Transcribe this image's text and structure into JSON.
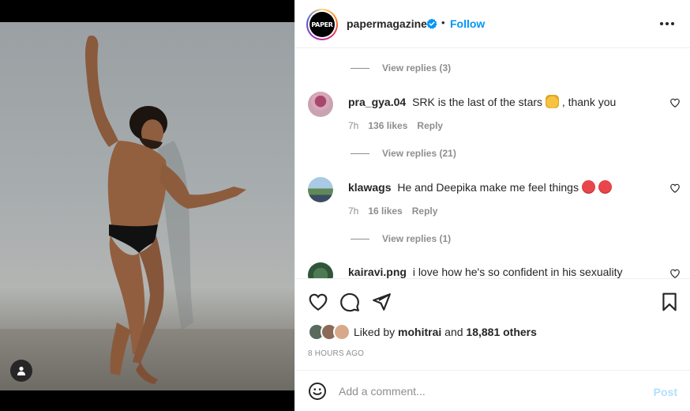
{
  "post": {
    "author": {
      "username": "papermagazine",
      "avatar_text": "PAPER",
      "verified": true,
      "follow_label": "Follow",
      "separator": "•"
    },
    "comments": [
      {
        "view_replies_above": "View replies (3)",
        "username": "pra_gya.04",
        "text_before": "SRK is the last of the stars",
        "emoji": "raising-hands",
        "text_after": ", thank you",
        "time": "7h",
        "likes": "136 likes",
        "reply_label": "Reply",
        "view_replies": "View replies (21)"
      },
      {
        "username": "klawags",
        "text_before": "He and Deepika make me feel things",
        "emoji": "pouting-face x2",
        "text_after": "",
        "time": "7h",
        "likes": "16 likes",
        "reply_label": "Reply",
        "view_replies": "View replies (1)"
      },
      {
        "username": "kairavi.png",
        "text_before": "i love how he's so confident in his sexuality",
        "text_after": ""
      }
    ],
    "liked_by": {
      "prefix": "Liked by",
      "user": "mohitrai",
      "connector": "and",
      "others": "18,881 others"
    },
    "timestamp": "8 HOURS AGO",
    "comment_box": {
      "placeholder": "Add a comment...",
      "post_label": "Post"
    }
  },
  "colors": {
    "accent": "#0095f6",
    "post_disabled": "#b2dffc",
    "muted": "#8e8e8e",
    "text": "#262626"
  },
  "icons": [
    "user-tag-icon",
    "verified-badge-icon",
    "more-options-icon",
    "heart-icon",
    "comment-icon",
    "share-icon",
    "bookmark-icon",
    "emoji-icon"
  ]
}
